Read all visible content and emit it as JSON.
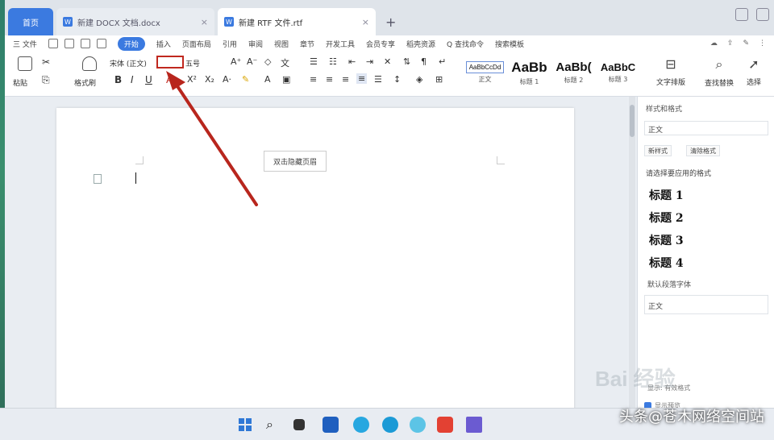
{
  "tabs": {
    "home": "首页",
    "doc1": "新建 DOCX 文档.docx",
    "doc2": "新建 RTF 文件.rtf",
    "close_glyph": "×",
    "add_glyph": "+"
  },
  "menu": {
    "file": "三 文件",
    "items": [
      "开始",
      "插入",
      "页面布局",
      "引用",
      "审阅",
      "视图",
      "章节",
      "开发工具",
      "会员专享",
      "稻壳资源"
    ],
    "search": "Q 查找命令",
    "search2": "搜索模板"
  },
  "ribbon": {
    "paste": "粘贴",
    "format_painter": "格式刷",
    "font_name": "宋体 (正文)",
    "font_size": "",
    "font_size_label": "五号",
    "bold": "B",
    "italic": "I",
    "underline": "U",
    "font_color": "A",
    "styles": [
      {
        "sample": "AaBbCcDd",
        "name": "正文"
      },
      {
        "sample": "AaBb",
        "name": "标题 1"
      },
      {
        "sample": "AaBb(",
        "name": "标题 2"
      },
      {
        "sample": "AaBbC",
        "name": "标题 3"
      }
    ],
    "text_layout": "文字排版",
    "find_replace": "查找替换",
    "select": "选择"
  },
  "document": {
    "tooltip": "双击隐藏页眉",
    "margin_icon": "▭ -"
  },
  "panel": {
    "header": "样式和格式",
    "current_style": "正文",
    "new_style_btn": "新样式",
    "clear_format_btn": "清除格式",
    "apply_section": "请选择要应用的格式",
    "headings": [
      "标题 1",
      "标题 2",
      "标题 3",
      "标题 4"
    ],
    "default_label": "默认段落字体",
    "default_value": "正文",
    "footer1": "显示: 有效格式",
    "footer2": "显示预览"
  },
  "watermark": "Bai 经验",
  "credit": "头条@苍木网络空间站",
  "colors": {
    "accent": "#3b7ae0",
    "highlight_red": "#c0281f"
  }
}
